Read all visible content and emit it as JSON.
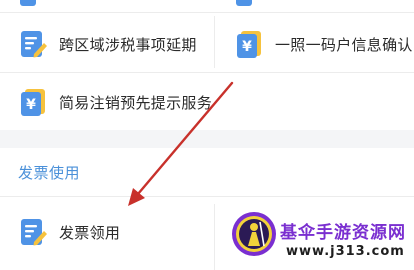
{
  "services": {
    "cross_region_extension": {
      "label": "跨区域涉税事项延期",
      "icon": "document-edit-icon"
    },
    "one_license_info_confirm": {
      "label": "一照一码户信息确认",
      "icon": "yuan-card-icon"
    },
    "simple_cancellation_notice": {
      "label": "简易注销预先提示服务",
      "icon": "yuan-card-icon"
    }
  },
  "invoice_section": {
    "title": "发票使用",
    "items": {
      "invoice_claim": {
        "label": "发票领用",
        "icon": "document-edit-icon"
      }
    }
  },
  "watermark": {
    "title": "基伞手游资源网",
    "url": "www.j313.com"
  },
  "colors": {
    "icon_blue": "#4f93e6",
    "icon_yellow": "#f6c23e",
    "section_title": "#4a90d9",
    "annotation_arrow": "#c8312b",
    "watermark_purple": "#7a2fd0"
  }
}
